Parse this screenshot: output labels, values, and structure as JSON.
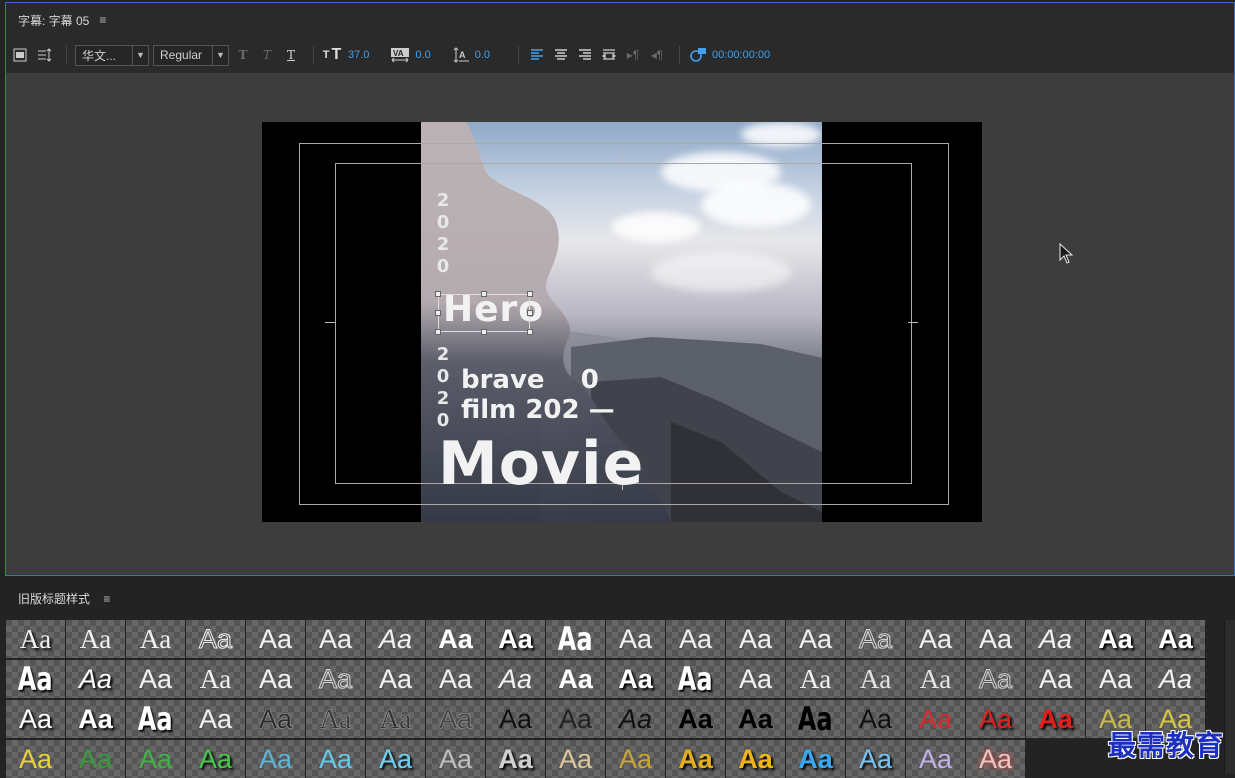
{
  "title_panel": {
    "tab_label": "字幕: 字幕 05",
    "menu_glyph": "≡"
  },
  "toolbar": {
    "font_family": "华文...",
    "font_style": "Regular",
    "font_size": "37.0",
    "kerning": "0.0",
    "leading": "0.0",
    "timecode": "00:00:00:00"
  },
  "canvas": {
    "year_top": "2\n0\n2\n0",
    "hero_text": "Hero",
    "year_mid": "2\n0\n2\n0",
    "line_brave": "brave    0",
    "line_film": "film 202 —",
    "movie_text": "Movie"
  },
  "styles_panel": {
    "header": "旧版标题样式",
    "menu_glyph": "≡",
    "swatch_label": "Aa",
    "rows": [
      [
        {
          "c": "#f2f2f2",
          "f": "serif",
          "w": "normal",
          "s": "normal",
          "e": "shadow"
        },
        {
          "c": "#f2f2f2",
          "f": "serif",
          "w": "normal",
          "s": "normal",
          "e": "none"
        },
        {
          "c": "#f2f2f2",
          "f": "serif",
          "w": "normal",
          "s": "normal",
          "e": "none"
        },
        {
          "c": "#f2f2f2",
          "f": "sans",
          "w": "normal",
          "s": "normal",
          "e": "outline"
        },
        {
          "c": "#f2f2f2",
          "f": "sans",
          "w": "normal",
          "s": "normal",
          "e": "none"
        },
        {
          "c": "#f2f2f2",
          "f": "sans",
          "w": "normal",
          "s": "normal",
          "e": "none"
        },
        {
          "c": "#f2f2f2",
          "f": "sans",
          "w": "normal",
          "s": "italic",
          "e": "none"
        },
        {
          "c": "#ffffff",
          "f": "sans",
          "w": "bold",
          "s": "normal",
          "e": "none"
        },
        {
          "c": "#ffffff",
          "f": "sans",
          "w": "bold",
          "s": "normal",
          "e": "shadow"
        },
        {
          "c": "#ffffff",
          "f": "cond",
          "w": "bold",
          "s": "normal",
          "e": "none"
        },
        {
          "c": "#f2f2f2",
          "f": "sans",
          "w": "normal",
          "s": "normal",
          "e": "none"
        },
        {
          "c": "#f2f2f2",
          "f": "sans",
          "w": "normal",
          "s": "normal",
          "e": "none"
        },
        {
          "c": "#f2f2f2",
          "f": "sans",
          "w": "normal",
          "s": "normal",
          "e": "none"
        },
        {
          "c": "#f2f2f2",
          "f": "sans",
          "w": "normal",
          "s": "normal",
          "e": "none"
        },
        {
          "c": "#d8d8d8",
          "f": "sans",
          "w": "normal",
          "s": "normal",
          "e": "outline"
        },
        {
          "c": "#f2f2f2",
          "f": "sans",
          "w": "normal",
          "s": "normal",
          "e": "none"
        },
        {
          "c": "#f2f2f2",
          "f": "sans",
          "w": "normal",
          "s": "normal",
          "e": "none"
        },
        {
          "c": "#f2f2f2",
          "f": "sans",
          "w": "normal",
          "s": "italic",
          "e": "none"
        },
        {
          "c": "#ffffff",
          "f": "sans",
          "w": "bold",
          "s": "normal",
          "e": "shadow"
        },
        {
          "c": "#ffffff",
          "f": "sans",
          "w": "bold",
          "s": "normal",
          "e": "shadow"
        }
      ],
      [
        {
          "c": "#ffffff",
          "f": "cond",
          "w": "bold",
          "s": "normal",
          "e": "shadow"
        },
        {
          "c": "#ffffff",
          "f": "sans",
          "w": "normal",
          "s": "italic",
          "e": "shadow"
        },
        {
          "c": "#f2f2f2",
          "f": "sans",
          "w": "normal",
          "s": "normal",
          "e": "none"
        },
        {
          "c": "#f2f2f2",
          "f": "serif",
          "w": "normal",
          "s": "normal",
          "e": "none"
        },
        {
          "c": "#f2f2f2",
          "f": "sans",
          "w": "normal",
          "s": "normal",
          "e": "none"
        },
        {
          "c": "#d8d8d8",
          "f": "sans",
          "w": "normal",
          "s": "normal",
          "e": "outline"
        },
        {
          "c": "#f2f2f2",
          "f": "sans",
          "w": "normal",
          "s": "normal",
          "e": "none"
        },
        {
          "c": "#f2f2f2",
          "f": "sans",
          "w": "normal",
          "s": "normal",
          "e": "none"
        },
        {
          "c": "#f2f2f2",
          "f": "sans",
          "w": "normal",
          "s": "italic",
          "e": "none"
        },
        {
          "c": "#ffffff",
          "f": "sans",
          "w": "bold",
          "s": "normal",
          "e": "none"
        },
        {
          "c": "#ffffff",
          "f": "sans",
          "w": "bold",
          "s": "normal",
          "e": "shadow"
        },
        {
          "c": "#ffffff",
          "f": "cond",
          "w": "bold",
          "s": "normal",
          "e": "shadow"
        },
        {
          "c": "#f2f2f2",
          "f": "sans",
          "w": "normal",
          "s": "normal",
          "e": "none"
        },
        {
          "c": "#f2f2f2",
          "f": "serif",
          "w": "normal",
          "s": "normal",
          "e": "none"
        },
        {
          "c": "#e4e4e4",
          "f": "serif",
          "w": "normal",
          "s": "normal",
          "e": "none"
        },
        {
          "c": "#e4e4e4",
          "f": "serif",
          "w": "normal",
          "s": "normal",
          "e": "none"
        },
        {
          "c": "#cfcfcf",
          "f": "sans",
          "w": "normal",
          "s": "normal",
          "e": "outline"
        },
        {
          "c": "#f2f2f2",
          "f": "sans",
          "w": "normal",
          "s": "normal",
          "e": "none"
        },
        {
          "c": "#f2f2f2",
          "f": "sans",
          "w": "normal",
          "s": "normal",
          "e": "none"
        },
        {
          "c": "#f2f2f2",
          "f": "sans",
          "w": "normal",
          "s": "italic",
          "e": "none"
        }
      ],
      [
        {
          "c": "#ffffff",
          "f": "sans",
          "w": "normal",
          "s": "normal",
          "e": "shadow"
        },
        {
          "c": "#ffffff",
          "f": "sans",
          "w": "bold",
          "s": "normal",
          "e": "shadow"
        },
        {
          "c": "#ffffff",
          "f": "cond",
          "w": "bold",
          "s": "normal",
          "e": "shadow"
        },
        {
          "c": "#f2f2f2",
          "f": "sans",
          "w": "normal",
          "s": "normal",
          "e": "none"
        },
        {
          "c": "#2a2a2a",
          "f": "sans",
          "w": "normal",
          "s": "normal",
          "e": "outline-light"
        },
        {
          "c": "#3a3a3a",
          "f": "serif",
          "w": "normal",
          "s": "normal",
          "e": "outline-light"
        },
        {
          "c": "#333333",
          "f": "serif",
          "w": "normal",
          "s": "normal",
          "e": "outline-light"
        },
        {
          "c": "#444444",
          "f": "sans",
          "w": "normal",
          "s": "normal",
          "e": "outline-light"
        },
        {
          "c": "#111111",
          "f": "sans",
          "w": "normal",
          "s": "normal",
          "e": "none"
        },
        {
          "c": "#222222",
          "f": "sans",
          "w": "normal",
          "s": "normal",
          "e": "none"
        },
        {
          "c": "#111111",
          "f": "sans",
          "w": "normal",
          "s": "italic",
          "e": "none"
        },
        {
          "c": "#000000",
          "f": "sans",
          "w": "bold",
          "s": "normal",
          "e": "none"
        },
        {
          "c": "#000000",
          "f": "sans",
          "w": "bold",
          "s": "normal",
          "e": "none"
        },
        {
          "c": "#000000",
          "f": "cond",
          "w": "bold",
          "s": "normal",
          "e": "none"
        },
        {
          "c": "#111111",
          "f": "sans",
          "w": "normal",
          "s": "normal",
          "e": "none"
        },
        {
          "c": "#d42b2b",
          "f": "sans",
          "w": "normal",
          "s": "normal",
          "e": "none"
        },
        {
          "c": "#e02020",
          "f": "sans",
          "w": "normal",
          "s": "normal",
          "e": "shadow"
        },
        {
          "c": "#e51c1c",
          "f": "sans",
          "w": "bold",
          "s": "normal",
          "e": "shadow"
        },
        {
          "c": "#c9b84a",
          "f": "sans",
          "w": "normal",
          "s": "normal",
          "e": "none"
        },
        {
          "c": "#d9c640",
          "f": "sans",
          "w": "normal",
          "s": "normal",
          "e": "none"
        }
      ],
      [
        {
          "c": "#e8d23c",
          "f": "sans",
          "w": "normal",
          "s": "normal",
          "e": "none"
        },
        {
          "c": "#3a9a3c",
          "f": "sans",
          "w": "normal",
          "s": "normal",
          "e": "none"
        },
        {
          "c": "#41b246",
          "f": "sans",
          "w": "normal",
          "s": "normal",
          "e": "none"
        },
        {
          "c": "#47c84c",
          "f": "sans",
          "w": "normal",
          "s": "normal",
          "e": "shadow"
        },
        {
          "c": "#5cb5d4",
          "f": "sans",
          "w": "normal",
          "s": "normal",
          "e": "none"
        },
        {
          "c": "#66c8e8",
          "f": "sans",
          "w": "normal",
          "s": "normal",
          "e": "none"
        },
        {
          "c": "#6fd2f2",
          "f": "sans",
          "w": "normal",
          "s": "normal",
          "e": "shadow"
        },
        {
          "c": "#bfbfbf",
          "f": "sans",
          "w": "normal",
          "s": "normal",
          "e": "none"
        },
        {
          "c": "#d0d0d0",
          "f": "sans",
          "w": "bold",
          "s": "normal",
          "e": "shadow"
        },
        {
          "c": "#d9c89a",
          "f": "sans",
          "w": "normal",
          "s": "normal",
          "e": "none"
        },
        {
          "c": "#c9a536",
          "f": "sans",
          "w": "normal",
          "s": "normal",
          "e": "none"
        },
        {
          "c": "#e0b020",
          "f": "sans",
          "w": "bold",
          "s": "normal",
          "e": "shadow"
        },
        {
          "c": "#f0b419",
          "f": "sans",
          "w": "bold",
          "s": "normal",
          "e": "shadow"
        },
        {
          "c": "#3aa8f0",
          "f": "sans",
          "w": "bold",
          "s": "normal",
          "e": "shadow"
        },
        {
          "c": "#79c4f2",
          "f": "sans",
          "w": "normal",
          "s": "normal",
          "e": "shadow"
        },
        {
          "c": "#c4b0e8",
          "f": "sans",
          "w": "normal",
          "s": "normal",
          "e": "none"
        },
        {
          "c": "#e8c8c0",
          "f": "sans",
          "w": "normal",
          "s": "normal",
          "e": "glow"
        }
      ]
    ]
  },
  "watermark": "最需教育"
}
